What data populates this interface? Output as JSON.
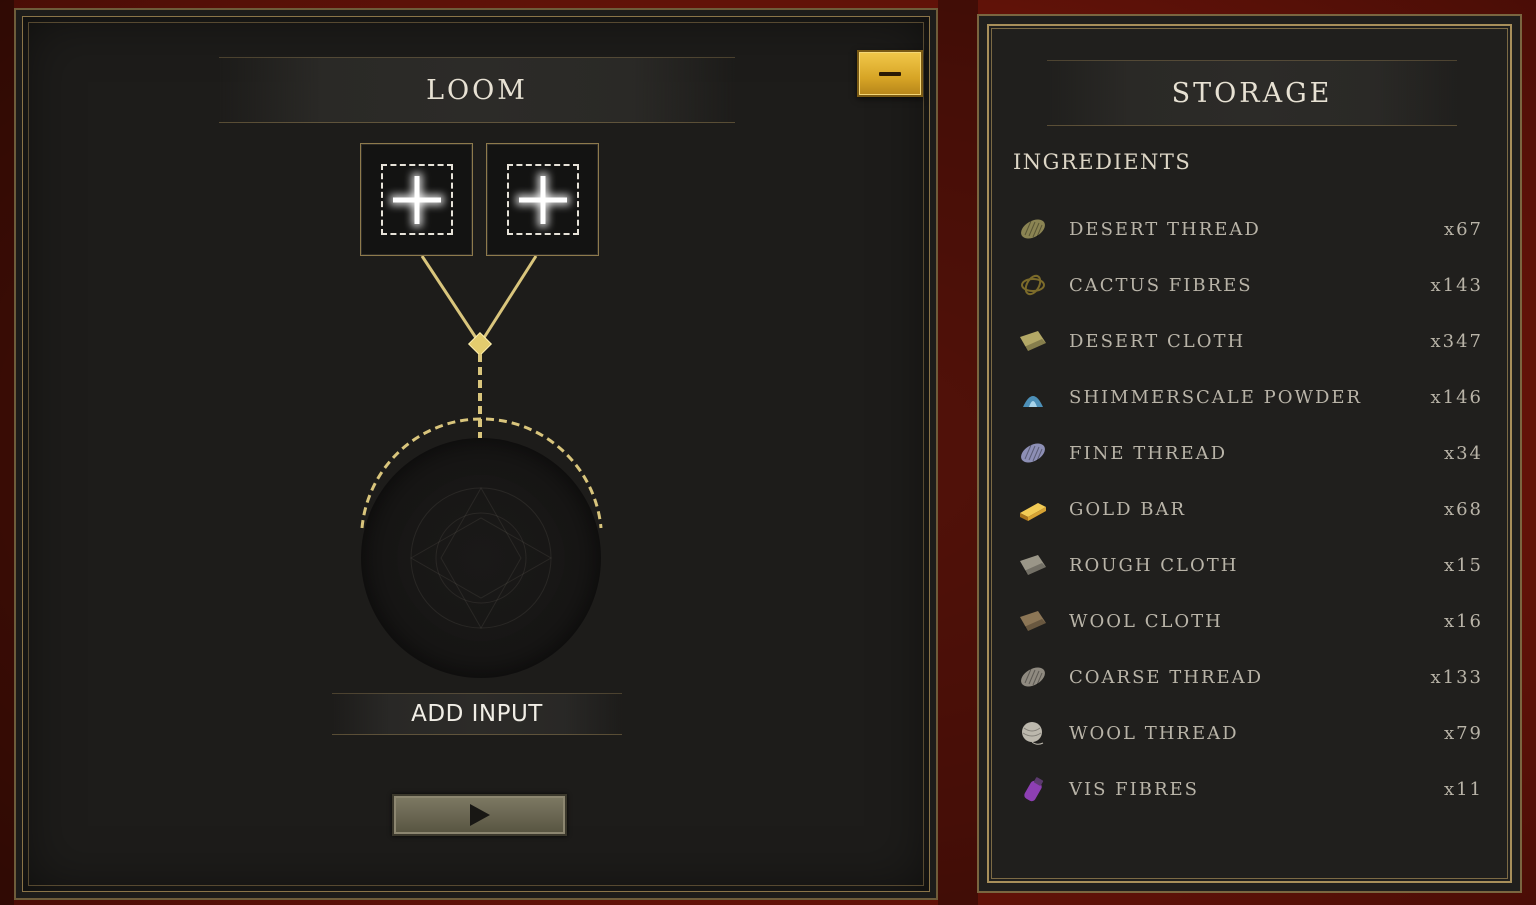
{
  "loom": {
    "title": "LOOM",
    "minimize_icon": "minus-icon",
    "input_slots": [
      {
        "icon": "plus-icon"
      },
      {
        "icon": "plus-icon"
      }
    ],
    "add_input_label": "ADD INPUT",
    "start_icon": "play-icon"
  },
  "storage": {
    "title": "STORAGE",
    "section": "INGREDIENTS",
    "items": [
      {
        "name": "DESERT THREAD",
        "count": "x67",
        "icon": "thread-spool-icon",
        "color": "#8b8453"
      },
      {
        "name": "CACTUS FIBRES",
        "count": "x143",
        "icon": "fibre-bundle-icon",
        "color": "#7c6b2a"
      },
      {
        "name": "DESERT CLOTH",
        "count": "x347",
        "icon": "cloth-icon",
        "color": "#b3a866"
      },
      {
        "name": "SHIMMERSCALE POWDER",
        "count": "x146",
        "icon": "powder-pile-icon",
        "color": "#4d90b8"
      },
      {
        "name": "FINE THREAD",
        "count": "x34",
        "icon": "thread-spool-icon",
        "color": "#8d8fb5"
      },
      {
        "name": "GOLD BAR",
        "count": "x68",
        "icon": "gold-bar-icon",
        "color": "#d7a333"
      },
      {
        "name": "ROUGH CLOTH",
        "count": "x15",
        "icon": "cloth-icon",
        "color": "#9a9688"
      },
      {
        "name": "WOOL CLOTH",
        "count": "x16",
        "icon": "cloth-icon",
        "color": "#8c7656"
      },
      {
        "name": "COARSE THREAD",
        "count": "x133",
        "icon": "thread-spool-icon",
        "color": "#8f8a80"
      },
      {
        "name": "WOOL THREAD",
        "count": "x79",
        "icon": "yarn-ball-icon",
        "color": "#bcb8ad"
      },
      {
        "name": "VIS FIBRES",
        "count": "x11",
        "icon": "fibre-vial-icon",
        "color": "#8d3fb3"
      }
    ]
  }
}
